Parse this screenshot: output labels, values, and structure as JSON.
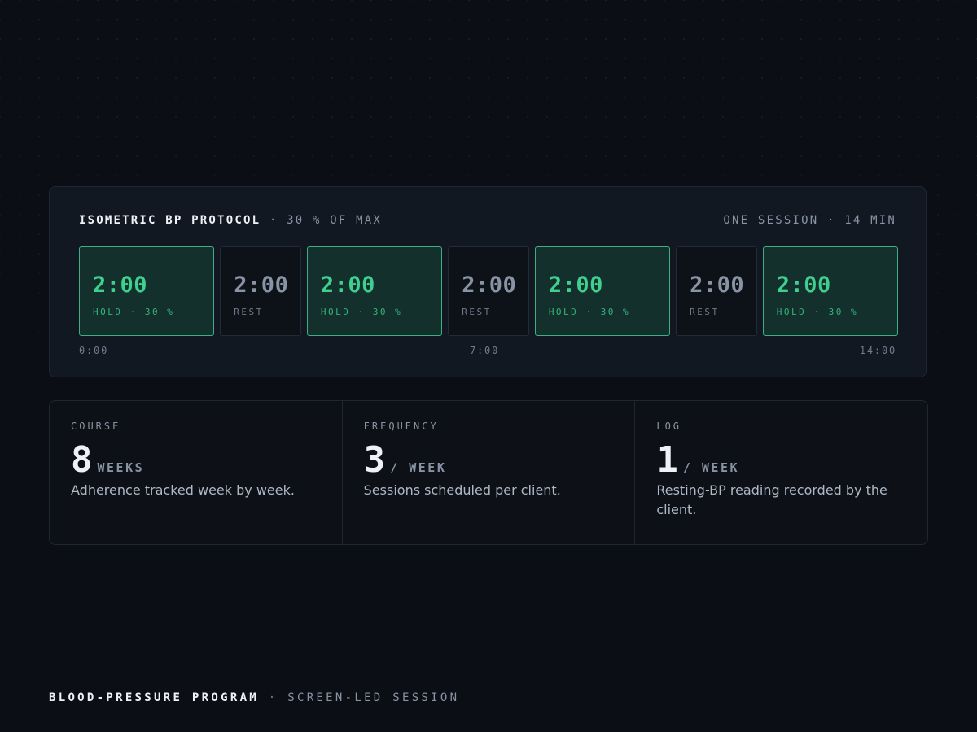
{
  "protocol": {
    "title": "ISOMETRIC BP PROTOCOL",
    "separator": " · ",
    "subtitle": "30 % OF MAX",
    "summary": "ONE SESSION · 14 MIN",
    "segments": [
      {
        "type": "hold",
        "time": "2:00",
        "label": "HOLD · 30 %"
      },
      {
        "type": "rest",
        "time": "2:00",
        "label": "REST"
      },
      {
        "type": "hold",
        "time": "2:00",
        "label": "HOLD · 30 %"
      },
      {
        "type": "rest",
        "time": "2:00",
        "label": "REST"
      },
      {
        "type": "hold",
        "time": "2:00",
        "label": "HOLD · 30 %"
      },
      {
        "type": "rest",
        "time": "2:00",
        "label": "REST"
      },
      {
        "type": "hold",
        "time": "2:00",
        "label": "HOLD · 30 %"
      }
    ],
    "timeline": {
      "start": "0:00",
      "mid": "7:00",
      "end": "14:00"
    }
  },
  "stats": {
    "course": {
      "label": "COURSE",
      "value": "8",
      "unit": "WEEKS",
      "description": "Adherence tracked week by week."
    },
    "frequency": {
      "label": "FREQUENCY",
      "value": "3",
      "unit": "/ WEEK",
      "description": "Sessions scheduled per client."
    },
    "log": {
      "label": "LOG",
      "value": "1",
      "unit": "/ WEEK",
      "description": "Resting-BP reading recorded by the client."
    }
  },
  "footer": {
    "title": "BLOOD-PRESSURE PROGRAM",
    "separator": " · ",
    "subtitle": "SCREEN-LED SESSION"
  },
  "colors": {
    "background": "#0b0e14",
    "hold_accent": "#3fd08f",
    "hold_border": "#3fae83",
    "hold_fill": "#14302d",
    "muted": "#8893a4"
  }
}
